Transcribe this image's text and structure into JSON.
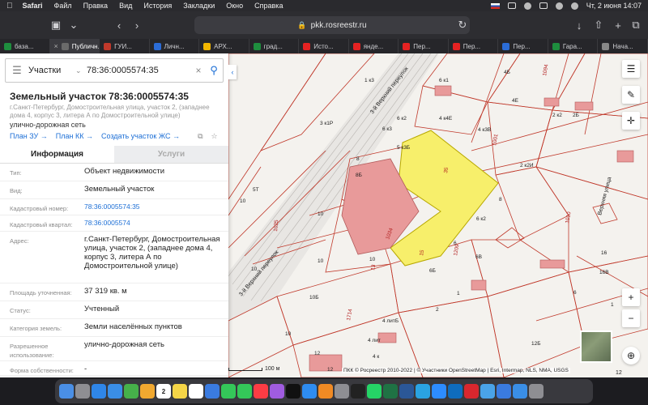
{
  "menubar": {
    "app": "Safari",
    "items": [
      "Файл",
      "Правка",
      "Вид",
      "История",
      "Закладки",
      "Окно",
      "Справка"
    ],
    "clock": "Чт, 2 июня  14:07"
  },
  "browser": {
    "url": "pkk.rosreestr.ru",
    "tabs": [
      {
        "label": "база...",
        "color": "#1e8e3e"
      },
      {
        "label": "Публичн...",
        "color": "#6a6a6a",
        "active": true
      },
      {
        "label": "ГУИ...",
        "color": "#c0392b"
      },
      {
        "label": "Личн...",
        "color": "#2b6cd6"
      },
      {
        "label": "АРХ...",
        "color": "#f2b600"
      },
      {
        "label": "град...",
        "color": "#1e8e3e"
      },
      {
        "label": "Исто...",
        "color": "#e52222"
      },
      {
        "label": "янде...",
        "color": "#e52222"
      },
      {
        "label": "Пер...",
        "color": "#e52222"
      },
      {
        "label": "Пер...",
        "color": "#e52222"
      },
      {
        "label": "Пер...",
        "color": "#2b6cd6"
      },
      {
        "label": "Гара...",
        "color": "#1e8e3e"
      },
      {
        "label": "Нача...",
        "color": "#888888"
      }
    ]
  },
  "panel": {
    "search": {
      "category": "Участки",
      "query": "78:36:0005574:35"
    },
    "title": "Земельный участок 78:36:0005574:35",
    "address_short": "г.Санкт-Петербург, Домостроительная улица, участок 2, (западнее дома 4, корпус 3, литера А по Домостроительной улице)",
    "use": "улично-дорожная сеть",
    "links": [
      "План ЗУ",
      "План КК",
      "Создать участок ЖС"
    ],
    "tabs": {
      "info": "Информация",
      "services": "Услуги"
    },
    "rows": [
      {
        "key": "Тип:",
        "value": "Объект недвижимости"
      },
      {
        "key": "Вид:",
        "value": "Земельный участок"
      },
      {
        "key": "Кадастровый номер:",
        "value": "78:36:0005574:35",
        "link": true
      },
      {
        "key": "Кадастровый квартал:",
        "value": "78:36:0005574",
        "link": true
      },
      {
        "key": "Адрес:",
        "value": "г.Санкт-Петербург, Домостроительная улица, участок 2, (западнее дома 4, корпус 3, литера А по Домостроительной улице)"
      },
      {
        "key": "Площадь уточненная:",
        "value": "37 319 кв. м"
      },
      {
        "key": "Статус:",
        "value": "Учтенный"
      },
      {
        "key": "Категория земель:",
        "value": "Земли населённых пунктов"
      },
      {
        "key": "Разрешенное использование:",
        "value": "улично-дорожная сеть"
      },
      {
        "key": "Форма собственности:",
        "value": "-"
      }
    ]
  },
  "map": {
    "scale": "100 м",
    "attribution": "ПКК © Росреестр 2010-2022 | © Участники OpenStreetMap | Esri, Intermap, NLS, NMA, USGS",
    "bottom_label": "12",
    "streets": {
      "upper": "3-й Верхний переулок",
      "left": "3-й Верхний переулок",
      "right": "Верхняя улица"
    },
    "colors": {
      "parcel": "#f7ef6b",
      "outline": "#c0392b",
      "building": "#e89a9a"
    }
  },
  "dock": {
    "calendar_day": "2",
    "apps": [
      "finder",
      "launchpad",
      "safari",
      "mail",
      "maps",
      "photos",
      "calendar",
      "notes",
      "reminders",
      "files",
      "messages",
      "facetime",
      "music",
      "podcasts",
      "tv",
      "appstore",
      "books",
      "prefs",
      "terminal",
      "whatsapp",
      "excel",
      "word",
      "tg",
      "zoom",
      "outlook",
      "acrobat",
      "preview",
      "bluetooth",
      "mail2",
      "trash"
    ]
  }
}
